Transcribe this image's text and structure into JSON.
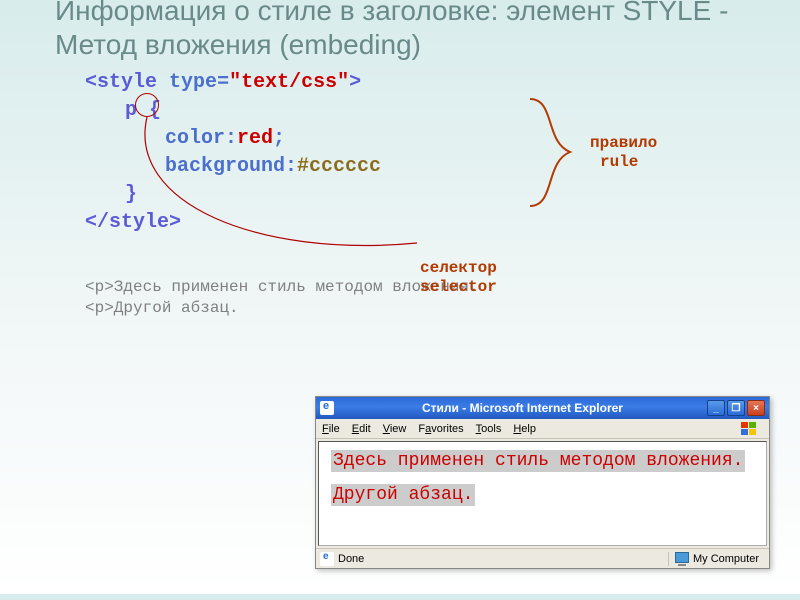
{
  "title": "Информация о стиле в заголовке: элемент STYLE - Метод вложения (embeding)",
  "code": {
    "open_angle": "<",
    "close_angle": ">",
    "slash": "/",
    "style_tag": "style",
    "type_attr": "type",
    "eq": "=",
    "type_val": "\"text/css\"",
    "selector": "p",
    "brace_open": "{",
    "prop_color": "color",
    "colon": ":",
    "val_red": "red",
    "semi": ";",
    "prop_bg": "background",
    "val_hex": "#cccccc",
    "brace_close": "}"
  },
  "annotations": {
    "rule_ru": "правило",
    "rule_en": "rule",
    "sel_ru": "селектор",
    "sel_en": "selector"
  },
  "sample_markup": {
    "line1": "<p>Здесь применен стиль методом вложения.",
    "line2": "<p>Другой абзац."
  },
  "browser": {
    "title": "Стили - Microsoft Internet Explorer",
    "menu": {
      "file": "File",
      "edit": "Edit",
      "view": "View",
      "favorites": "Favorites",
      "tools": "Tools",
      "help": "Help"
    },
    "content": {
      "p1": "Здесь применен стиль методом вложения.",
      "p2": "Другой абзац."
    },
    "status_done": "Done",
    "status_zone": "My Computer"
  }
}
